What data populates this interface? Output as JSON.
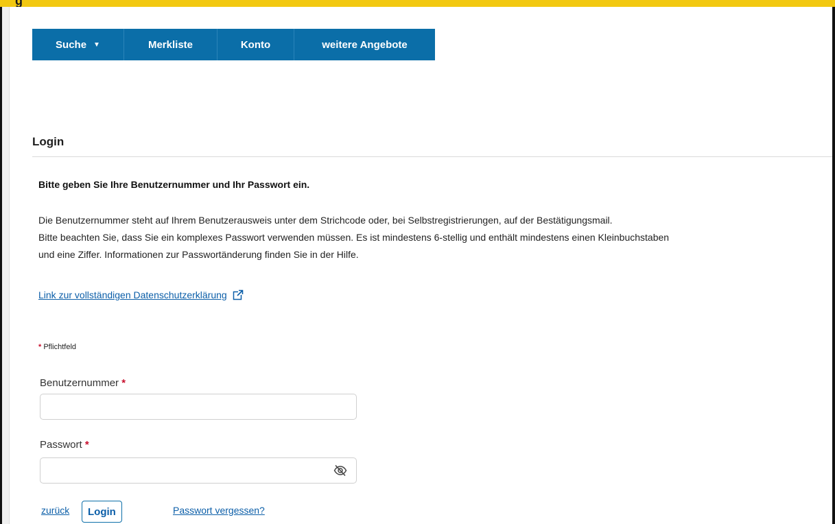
{
  "nav": {
    "search": "Suche",
    "watchlist": "Merkliste",
    "account": "Konto",
    "more_offers": "weitere Angebote"
  },
  "login": {
    "heading": "Login",
    "intro_bold": "Bitte geben Sie Ihre Benutzernummer und Ihr Passwort ein.",
    "info_line_1": "Die Benutzernummer steht auf Ihrem Benutzerausweis unter dem Strichcode oder, bei Selbstregistrierungen, auf der Bestätigungsmail.",
    "info_line_2": "Bitte beachten Sie, dass Sie ein komplexes Passwort verwenden müssen. Es ist mindestens 6-stellig und enthält mindestens einen Kleinbuchstaben",
    "info_line_3": "und eine Ziffer. Informationen zur Passwortänderung finden Sie in der Hilfe.",
    "privacy_link": "Link zur vollständigen Datenschutzerklärung",
    "required_marker": "*",
    "required_note": "Pflichtfeld",
    "user_label": "Benutzernummer",
    "user_value": "",
    "password_label": "Passwort",
    "password_value": "",
    "back_link": "zurück",
    "login_button": "Login",
    "forgot_link": "Passwort vergessen?"
  },
  "icons": {
    "search_caret": "caret-down-icon",
    "privacy_external": "external-link-icon",
    "password_toggle": "eye-slash-icon"
  },
  "colors": {
    "nav_background": "#0b6ea8",
    "link": "#0b5ea8",
    "required": "#c8102e",
    "top_strip": "#f2c811"
  }
}
